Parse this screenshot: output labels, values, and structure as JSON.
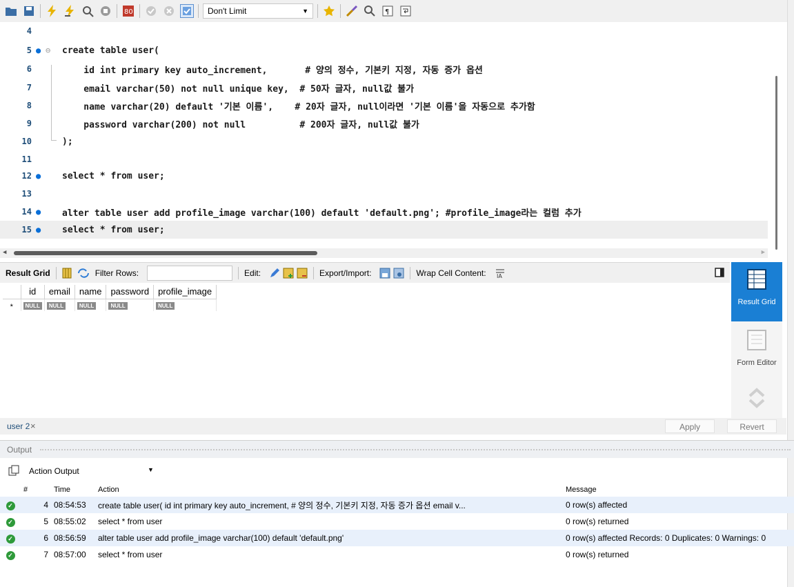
{
  "toolbar": {
    "limit_value": "Don't Limit",
    "icons": [
      "folder-open-icon",
      "save-icon",
      "execute-icon",
      "execute-current-icon",
      "explain-icon",
      "stop-icon",
      "toggle-error-icon",
      "commit-icon",
      "rollback-icon",
      "autocommit-icon",
      "bookmark-icon",
      "beautify-icon",
      "find-icon",
      "invisible-chars-icon",
      "wrap-icon"
    ]
  },
  "editor": {
    "lines": [
      {
        "num": "4",
        "dot": "",
        "text": ""
      },
      {
        "num": "5",
        "dot": "●",
        "text": "create table user("
      },
      {
        "num": "6",
        "dot": "",
        "text": "    id int primary key auto_increment,       # 양의 정수, 기본키 지정, 자동 증가 옵션"
      },
      {
        "num": "7",
        "dot": "",
        "text": "    email varchar(50) not null unique key,  # 50자 글자, null값 불가"
      },
      {
        "num": "8",
        "dot": "",
        "text": "    name varchar(20) default '기본 이름',    # 20자 글자, null이라면 '기본 이름'을 자동으로 추가함"
      },
      {
        "num": "9",
        "dot": "",
        "text": "    password varchar(200) not null          # 200자 글자, null값 불가"
      },
      {
        "num": "10",
        "dot": "",
        "text": ");"
      },
      {
        "num": "11",
        "dot": "",
        "text": ""
      },
      {
        "num": "12",
        "dot": "●",
        "text": "select * from user;"
      },
      {
        "num": "13",
        "dot": "",
        "text": ""
      },
      {
        "num": "14",
        "dot": "●",
        "text": "alter table user add profile_image varchar(100) default 'default.png'; #profile_image라는 컬럼 추가"
      },
      {
        "num": "15",
        "dot": "●",
        "text": "select * from user;"
      }
    ]
  },
  "result_toolbar": {
    "result_grid": "Result Grid",
    "filter_rows": "Filter Rows:",
    "edit": "Edit:",
    "export_import": "Export/Import:",
    "wrap": "Wrap Cell Content:"
  },
  "grid": {
    "columns": [
      "id",
      "email",
      "name",
      "password",
      "profile_image"
    ],
    "row_marker": "*",
    "null_label": "NULL"
  },
  "side_panel": {
    "result_grid": "Result Grid",
    "form_editor": "Form Editor"
  },
  "tabbar": {
    "tab_label": "user 2",
    "close": "×",
    "apply": "Apply",
    "revert": "Revert"
  },
  "output": {
    "title": "Output",
    "selector": "Action Output",
    "headers": {
      "num": "#",
      "time": "Time",
      "action": "Action",
      "message": "Message"
    },
    "rows": [
      {
        "num": "4",
        "time": "08:54:53",
        "action": "create table user(     id int primary key auto_increment,      # 양의 정수, 기본키 지정, 자동 증가 옵션     email v...",
        "message": "0 row(s) affected"
      },
      {
        "num": "5",
        "time": "08:55:02",
        "action": "select * from user",
        "message": "0 row(s) returned"
      },
      {
        "num": "6",
        "time": "08:56:59",
        "action": "alter table user add profile_image varchar(100) default 'default.png'",
        "message": "0 row(s) affected Records: 0  Duplicates: 0  Warnings: 0"
      },
      {
        "num": "7",
        "time": "08:57:00",
        "action": "select * from user",
        "message": "0 row(s) returned"
      }
    ]
  },
  "colors": {
    "accent": "#1a7fd4",
    "keyword": "#1c73c8",
    "number": "#e07a00",
    "ok": "#2e9a3a"
  }
}
